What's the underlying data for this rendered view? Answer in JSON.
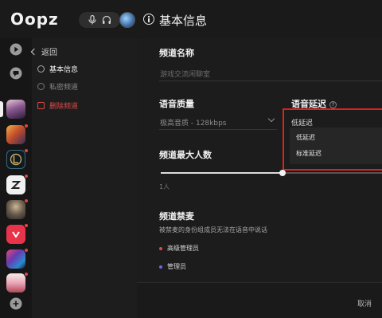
{
  "app": {
    "logo_text": "Oopz",
    "page_title": "基本信息"
  },
  "nav": {
    "back_label": "返回",
    "items": [
      {
        "label": "基本信息",
        "state": "active"
      },
      {
        "label": "私密频道",
        "state": "normal"
      },
      {
        "label": "删除频道",
        "state": "danger"
      }
    ]
  },
  "form": {
    "channel_name": {
      "label": "频道名称",
      "placeholder": "游戏交流闲聊室"
    },
    "voice_quality": {
      "label": "语音质量",
      "value": "极高音质 - 128kbps"
    },
    "voice_latency": {
      "label": "语音延迟",
      "help_glyph": "?",
      "current": "低延迟",
      "options": [
        "低延迟",
        "标准延迟"
      ]
    },
    "max_members": {
      "label": "频道最大人数",
      "value_text": "1人",
      "slider_fraction": 0.55
    },
    "channel_mute": {
      "label": "频道禁麦",
      "description": "被禁麦的身份组成员无法在语音中说话",
      "roles": [
        {
          "name": "高级管理员",
          "color": "#e04848"
        },
        {
          "name": "管理员",
          "color": "#6a6adf"
        }
      ]
    }
  },
  "footer": {
    "cancel_label": "取消"
  },
  "colors": {
    "highlight_box": "#e02020",
    "danger": "#e04848",
    "notification_dot": "#e04545"
  },
  "rail": {
    "servers": [
      {
        "icon": "anime-girl-server-icon",
        "badge": false,
        "selected": true
      },
      {
        "icon": "game-art-server-icon",
        "badge": true
      },
      {
        "icon": "league-logo-server-icon",
        "badge": true
      },
      {
        "icon": "z-logo-server-icon",
        "badge": true
      },
      {
        "icon": "character-server-icon",
        "badge": true
      },
      {
        "icon": "red-v-server-icon",
        "badge": true
      },
      {
        "icon": "colorful-game-server-icon",
        "badge": true
      },
      {
        "icon": "anime-art-server-icon",
        "badge": true
      }
    ]
  }
}
